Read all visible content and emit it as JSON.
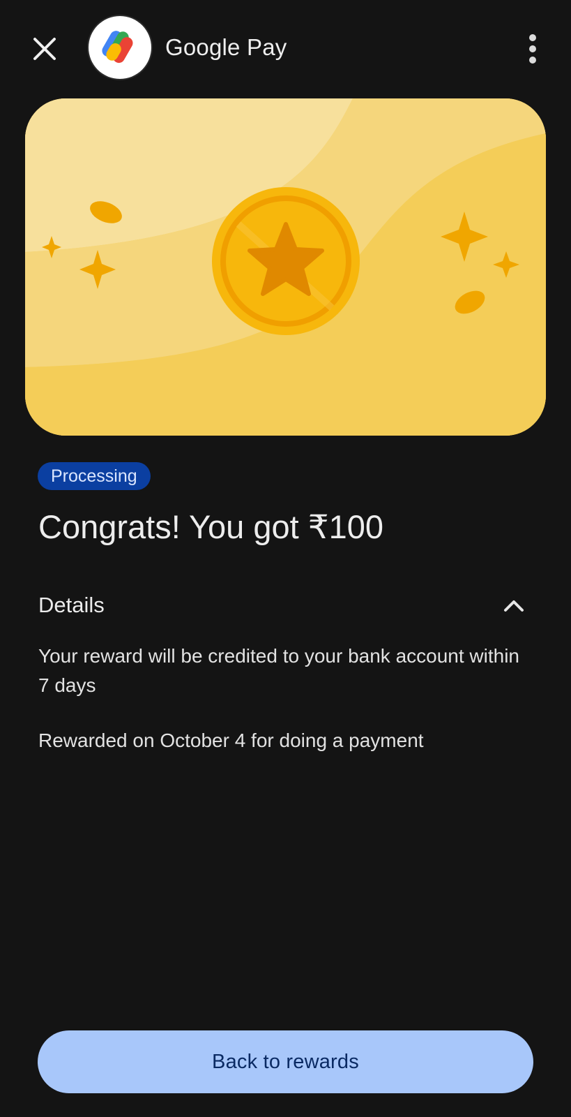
{
  "header": {
    "app_name": "Google Pay",
    "close_icon": "close-icon",
    "more_icon": "more-vert-icon"
  },
  "banner": {
    "icon": "star-coin-icon",
    "colors": {
      "background": "#f6cf5d",
      "coin": "#f6b400",
      "star": "#e08900"
    }
  },
  "reward": {
    "status": "Processing",
    "headline": "Congrats! You got ₹100"
  },
  "details": {
    "title": "Details",
    "toggle_icon": "chevron-up-icon",
    "lines": [
      "Your reward will be credited to your bank account within 7 days",
      "Rewarded on October 4 for doing a payment"
    ]
  },
  "actions": {
    "back_label": "Back to rewards"
  },
  "colors": {
    "page_background": "#141414",
    "badge": "#0b3fa1",
    "button": "#a8c7fa",
    "button_text": "#0a2a63"
  }
}
